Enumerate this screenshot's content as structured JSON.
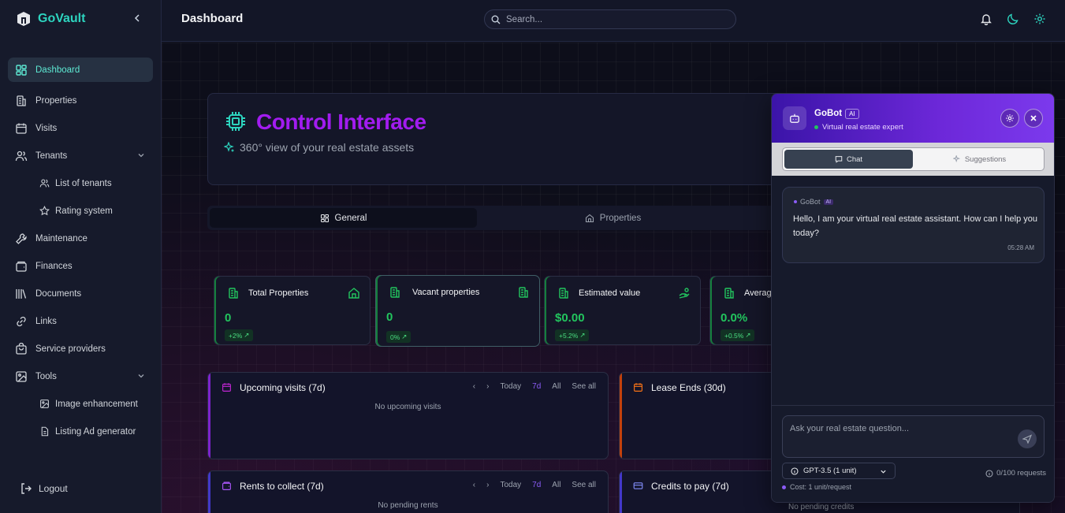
{
  "app": {
    "name": "GoVault"
  },
  "sidebar": {
    "items": [
      {
        "label": "Dashboard",
        "icon": "dashboard-icon"
      },
      {
        "label": "Properties",
        "icon": "building-icon"
      },
      {
        "label": "Visits",
        "icon": "calendar-icon"
      },
      {
        "label": "Tenants",
        "icon": "users-icon"
      },
      {
        "label": "List of tenants",
        "icon": "users-icon"
      },
      {
        "label": "Rating system",
        "icon": "star-icon"
      },
      {
        "label": "Maintenance",
        "icon": "wrench-icon"
      },
      {
        "label": "Finances",
        "icon": "wallet-icon"
      },
      {
        "label": "Documents",
        "icon": "library-icon"
      },
      {
        "label": "Links",
        "icon": "link-icon"
      },
      {
        "label": "Service providers",
        "icon": "bag-icon"
      },
      {
        "label": "Tools",
        "icon": "image-icon"
      },
      {
        "label": "Image enhancement",
        "icon": "image-icon"
      },
      {
        "label": "Listing Ad generator",
        "icon": "file-icon"
      }
    ],
    "logout": "Logout"
  },
  "header": {
    "title": "Dashboard",
    "search_placeholder": "Search..."
  },
  "hero": {
    "title": "Control Interface",
    "subtitle": "360° view of your real estate assets"
  },
  "tabs": [
    {
      "label": "General"
    },
    {
      "label": "Properties"
    }
  ],
  "stats": [
    {
      "title": "Total Properties",
      "value": "0",
      "badge": "+2%"
    },
    {
      "title": "Vacant properties",
      "value": "0",
      "badge": "0%"
    },
    {
      "title": "Estimated value",
      "value": "$0.00",
      "badge": "+5.2%"
    },
    {
      "title": "Average",
      "value": "0.0%",
      "badge": "+0.5%"
    }
  ],
  "panels": {
    "visits": {
      "title": "Upcoming visits (7d)",
      "empty": "No upcoming visits"
    },
    "leases": {
      "title": "Lease Ends (30d)"
    },
    "rents": {
      "title": "Rents to collect (7d)",
      "empty": "No pending rents"
    },
    "credits": {
      "title": "Credits to pay (7d)",
      "empty": "No pending credits"
    },
    "controls": {
      "prev": "‹",
      "next": "›",
      "today": "Today",
      "week": "7d",
      "all": "All",
      "see_all": "See all"
    }
  },
  "chat": {
    "bot_name": "GoBot",
    "ai_tag": "AI",
    "status": "Virtual real estate expert",
    "tabs": {
      "chat": "Chat",
      "suggestions": "Suggestions"
    },
    "message": {
      "from": "GoBot",
      "text": "Hello, I am your virtual real estate assistant. How can I help you today?",
      "time": "05:28 AM"
    },
    "input_placeholder": "Ask your real estate question...",
    "model": "GPT-3.5 (1 unit)",
    "cost": "Cost: 1 unit/request",
    "requests": "0/100 requests"
  },
  "colors": {
    "accent": "#2dd4bf",
    "purple": "#a21cf0",
    "green": "#22c55e"
  }
}
